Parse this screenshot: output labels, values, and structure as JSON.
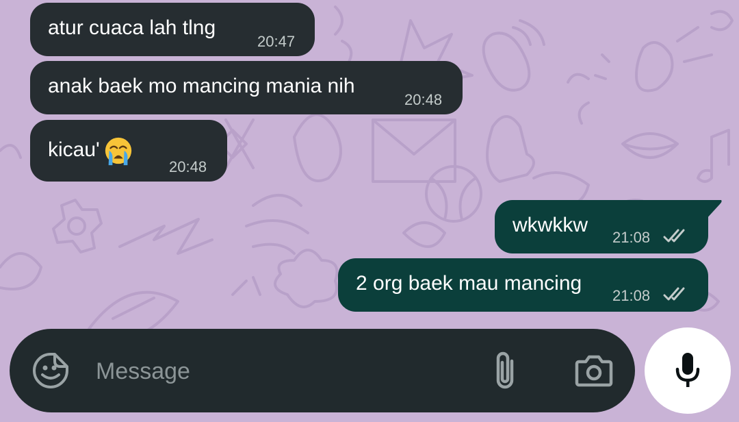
{
  "messages": [
    {
      "direction": "incoming",
      "text": "atur cuaca lah tlng",
      "time": "20:47"
    },
    {
      "direction": "incoming",
      "text": "anak baek mo mancing mania nih",
      "time": "20:48"
    },
    {
      "direction": "incoming",
      "text": "kicau'",
      "emoji": "loudly-crying-face-emoji",
      "time": "20:48"
    },
    {
      "direction": "outgoing",
      "text": "wkwkkw",
      "time": "21:08",
      "status": "read-double-check"
    },
    {
      "direction": "outgoing",
      "text": "2 org baek mau mancing",
      "time": "21:08",
      "status": "read-double-check"
    }
  ],
  "composer": {
    "placeholder": "Message",
    "icons": [
      "sticker-icon",
      "attach-icon",
      "camera-icon",
      "microphone-icon"
    ]
  },
  "colors": {
    "wallpaper": "#c9b3d6",
    "incoming_bubble": "#262d31",
    "outgoing_bubble": "#0b3f3b",
    "composer": "#212a2d",
    "mic_button": "#ffffff"
  }
}
